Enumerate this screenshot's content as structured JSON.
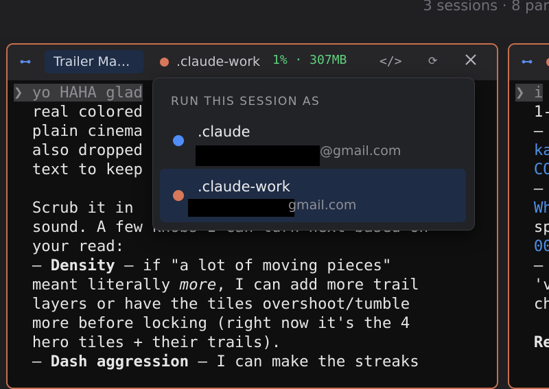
{
  "topbar": {
    "sessions_text": "3 sessions · 8 par"
  },
  "left_pane": {
    "tab_title": "Trailer Ma…",
    "profile_name": ".claude-work",
    "stats": "1% · 307MB",
    "code_icon": "</>",
    "refresh_icon": "⟳",
    "lines": {
      "l1": "❯ yo HAHA glad",
      "l2": "  real colored",
      "l3": "  plain cinema",
      "l4": "  also dropped",
      "l5": "  text to keep",
      "l7": "  Scrub it in",
      "l8": "  sound. A few knobs I can turn next based on",
      "l9": "  your read:",
      "l10_dash": "  – ",
      "l10_bold": "Density",
      "l10_rest": " – if \"a lot of moving pieces\"",
      "l11_start": "  meant literally ",
      "l11_em": "more",
      "l11_rest": ", I can add more trail",
      "l12": "  layers or have the tiles overshoot/tumble",
      "l13": "  more before locking (right now it's the 4",
      "l14": "  hero tiles + their trails).",
      "l15_dash": "  – ",
      "l15_bold": "Dash aggression",
      "l15_rest": " – I can make the streaks"
    }
  },
  "right_pane": {
    "lines": [
      "❯ i",
      "  1-",
      "  –",
      "  ka",
      "  CO",
      "  –",
      "  Wh",
      "  sp",
      "  00",
      "  –",
      "  'v",
      "  ch",
      "",
      "  Re"
    ]
  },
  "popup": {
    "heading": "RUN THIS SESSION AS",
    "options": [
      {
        "name": ".claude",
        "email": "@gmail.com",
        "dot_color": "#4f8ef7"
      },
      {
        "name": ".claude-work",
        "email": "@gmail.com",
        "dot_color": "#d8785a"
      }
    ]
  },
  "colors": {
    "accent_border": "#c7704d",
    "stats_green": "#5fd07e",
    "selected_bg": "#1e2c45"
  },
  "icons": [
    "link-icon",
    "close-icon",
    "code-icon",
    "refresh-icon"
  ]
}
